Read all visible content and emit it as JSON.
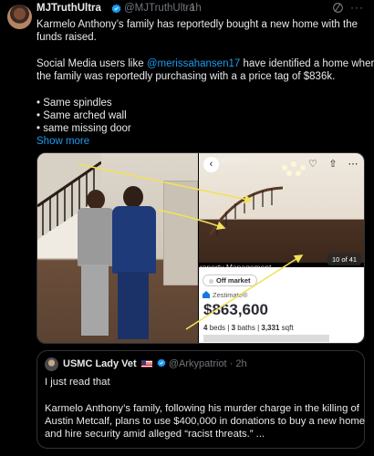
{
  "author": {
    "name": "MJTruthUltra",
    "handle": "@MJTruthUltra",
    "separator": "·",
    "time": "1h"
  },
  "post": {
    "line1": "Karmelo Anthony’s family has reportedly bought a new home with the",
    "line2": "funds raised.",
    "line3a": "Social Media users like ",
    "mention": "@merissahansen17",
    "line3b": " have identified a home where",
    "line4": "the family was reportedly purchasing with a a price tag of $836k.",
    "bullet1": "• Same spindles",
    "bullet2": "• Same arched wall",
    "bullet3": "• same missing door",
    "show_more": "Show more"
  },
  "listing": {
    "watermark": "roperty Management",
    "watermark_top": "PROPERTY",
    "photo_count": "10 of 41",
    "status": "Off market",
    "zestimate_label": "Zestimate®",
    "price": "$863,600",
    "beds": "4",
    "beds_label": "beds",
    "baths": "3",
    "baths_label": "baths",
    "sqft": "3,331",
    "sqft_label": "sqft",
    "back_glyph": "‹",
    "icon_glyphs": [
      "♡",
      "⇧",
      "⋯"
    ]
  },
  "quote": {
    "name": "USMC Lady Vet",
    "handle": "@Arkypatriot",
    "separator": "·",
    "time": "2h",
    "line1": "I just read that",
    "line2": "Karmelo Anthony’s family, following his murder charge in the killing of",
    "line3": "Austin Metcalf, plans to use $400,000 in donations to buy a new home",
    "line4": "and hire security amid alleged “racist threats.” ..."
  },
  "ui": {
    "more_glyph": "···"
  },
  "colors": {
    "background": "#000000",
    "text": "#e7e9ea",
    "secondary": "#71767b",
    "link": "#1d9bf0",
    "border": "#2f3336",
    "arrow": "#f2e15a"
  },
  "icons": [
    "verified-badge-icon",
    "grok-icon",
    "more-icon",
    "back-icon",
    "heart-icon",
    "share-icon",
    "zestimate-icon",
    "flag-icon"
  ]
}
